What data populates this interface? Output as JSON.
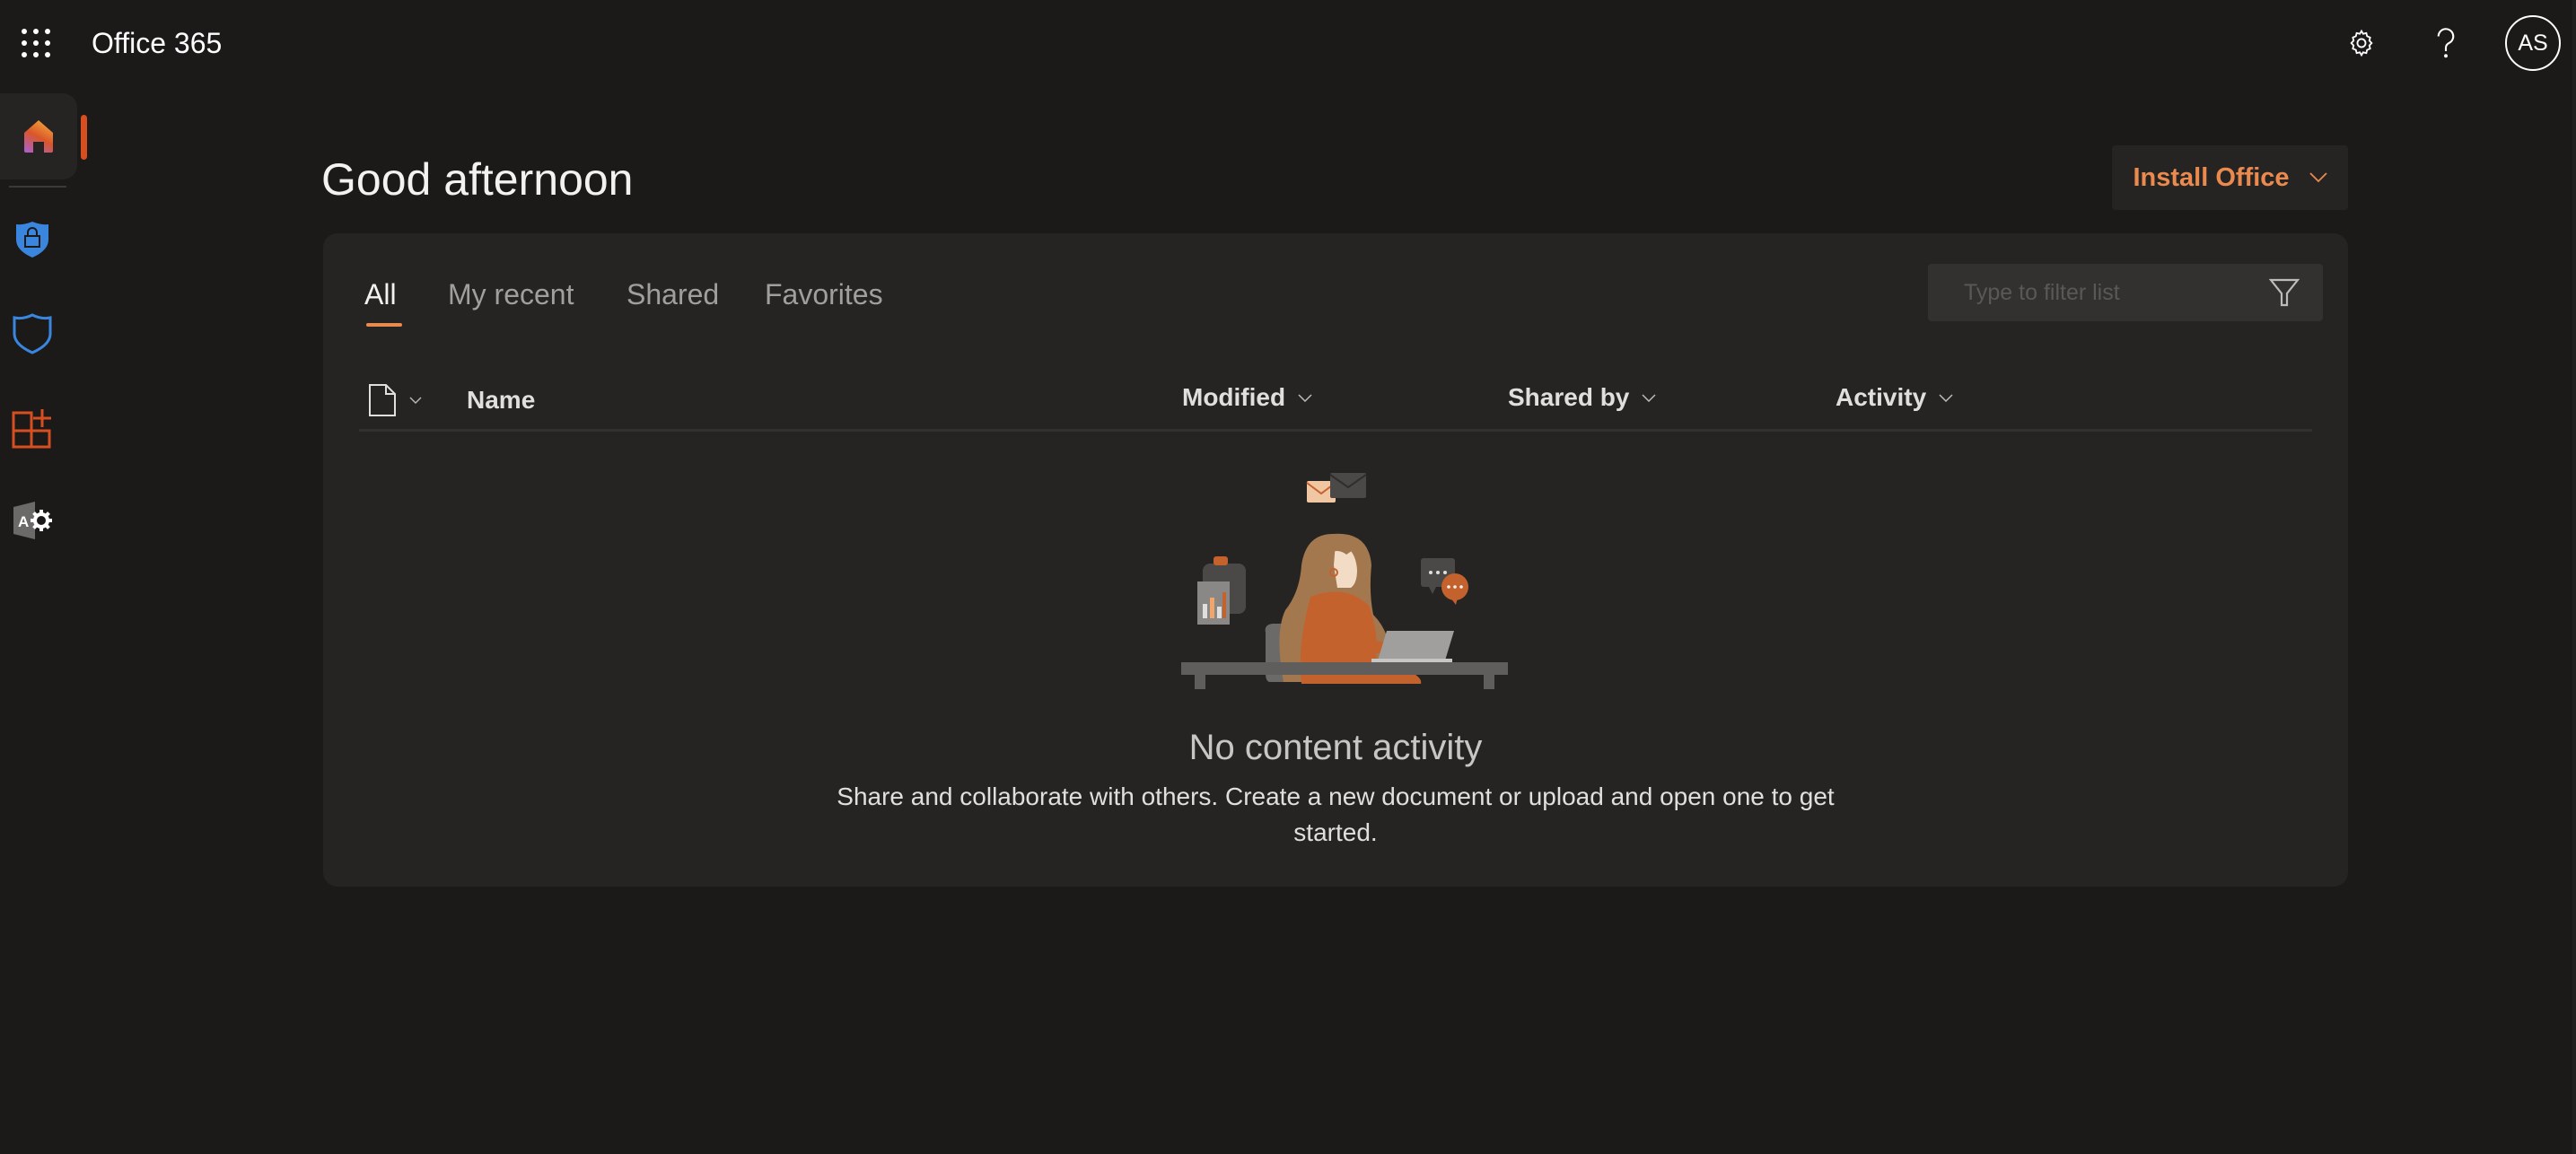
{
  "topbar": {
    "app_title": "Office 365",
    "waffle_icon": "app-launcher-icon",
    "settings_icon": "gear-icon",
    "help_icon": "question-icon",
    "avatar_initials": "AS"
  },
  "sidebar": {
    "items": [
      {
        "name": "home",
        "icon": "home-icon",
        "active": true
      },
      {
        "name": "security",
        "icon": "shield-lock-icon"
      },
      {
        "name": "defender",
        "icon": "shield-icon"
      },
      {
        "name": "add-apps",
        "icon": "grid-plus-icon"
      },
      {
        "name": "admin",
        "icon": "admin-gear-icon"
      }
    ]
  },
  "main": {
    "greeting": "Good afternoon",
    "install_button": {
      "label": "Install Office"
    },
    "tabs": [
      {
        "label": "All",
        "active": true
      },
      {
        "label": "My recent"
      },
      {
        "label": "Shared"
      },
      {
        "label": "Favorites"
      }
    ],
    "filter": {
      "placeholder": "Type to filter list",
      "value": ""
    },
    "columns": [
      {
        "label": "Name"
      },
      {
        "label": "Modified"
      },
      {
        "label": "Shared by"
      },
      {
        "label": "Activity"
      }
    ],
    "empty_state": {
      "title": "No content activity",
      "description": "Share and collaborate with others. Create a new document or upload and open one to get started."
    }
  },
  "colors": {
    "background": "#1b1a19",
    "card": "#252423",
    "accent": "#eb8a4f",
    "active_indicator": "#d74f21"
  }
}
